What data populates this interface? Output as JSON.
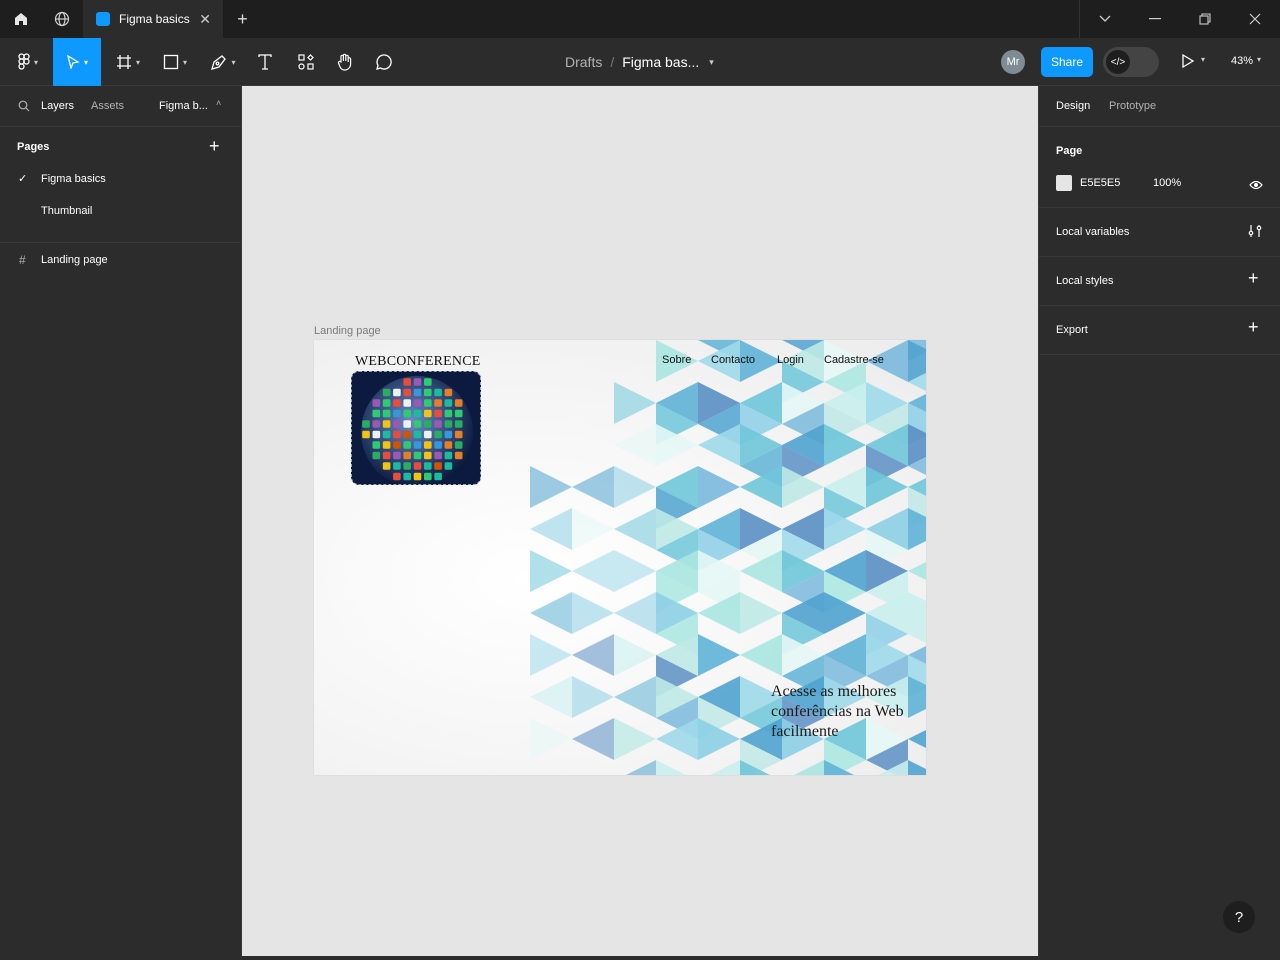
{
  "titlebar": {
    "tab_title": "Figma basics",
    "home_icon": "home-icon",
    "community_icon": "globe-icon",
    "new_tab": "+"
  },
  "toolbar": {
    "breadcrumb_drafts": "Drafts",
    "breadcrumb_sep": "/",
    "file_name": "Figma bas...",
    "avatar_initials": "Mr",
    "share_label": "Share",
    "zoom": "43%"
  },
  "left_panel": {
    "tabs": {
      "layers": "Layers",
      "assets": "Assets",
      "file": "Figma b..."
    },
    "pages_header": "Pages",
    "pages": [
      {
        "label": "Figma basics",
        "selected": true
      },
      {
        "label": "Thumbnail",
        "selected": false
      }
    ],
    "layers": [
      {
        "label": "Landing page",
        "type": "frame"
      }
    ]
  },
  "canvas": {
    "frame_label": "Landing page",
    "landing": {
      "brand": "WEBCONFERENCE",
      "nav": [
        "Sobre",
        "Contacto",
        "Login",
        "Cadastre-se"
      ],
      "tagline": "Acesse as melhores conferências na Web facilmente"
    }
  },
  "right_panel": {
    "tabs": {
      "design": "Design",
      "prototype": "Prototype"
    },
    "page_section": "Page",
    "page_color": "E5E5E5",
    "page_opacity": "100%",
    "local_variables": "Local variables",
    "local_styles": "Local styles",
    "export": "Export"
  },
  "help": "?",
  "colors": {
    "accent": "#0d99ff",
    "canvas_bg": "#e5e5e5",
    "panel_bg": "#2c2c2c",
    "titlebar_bg": "#1e1e1e"
  }
}
